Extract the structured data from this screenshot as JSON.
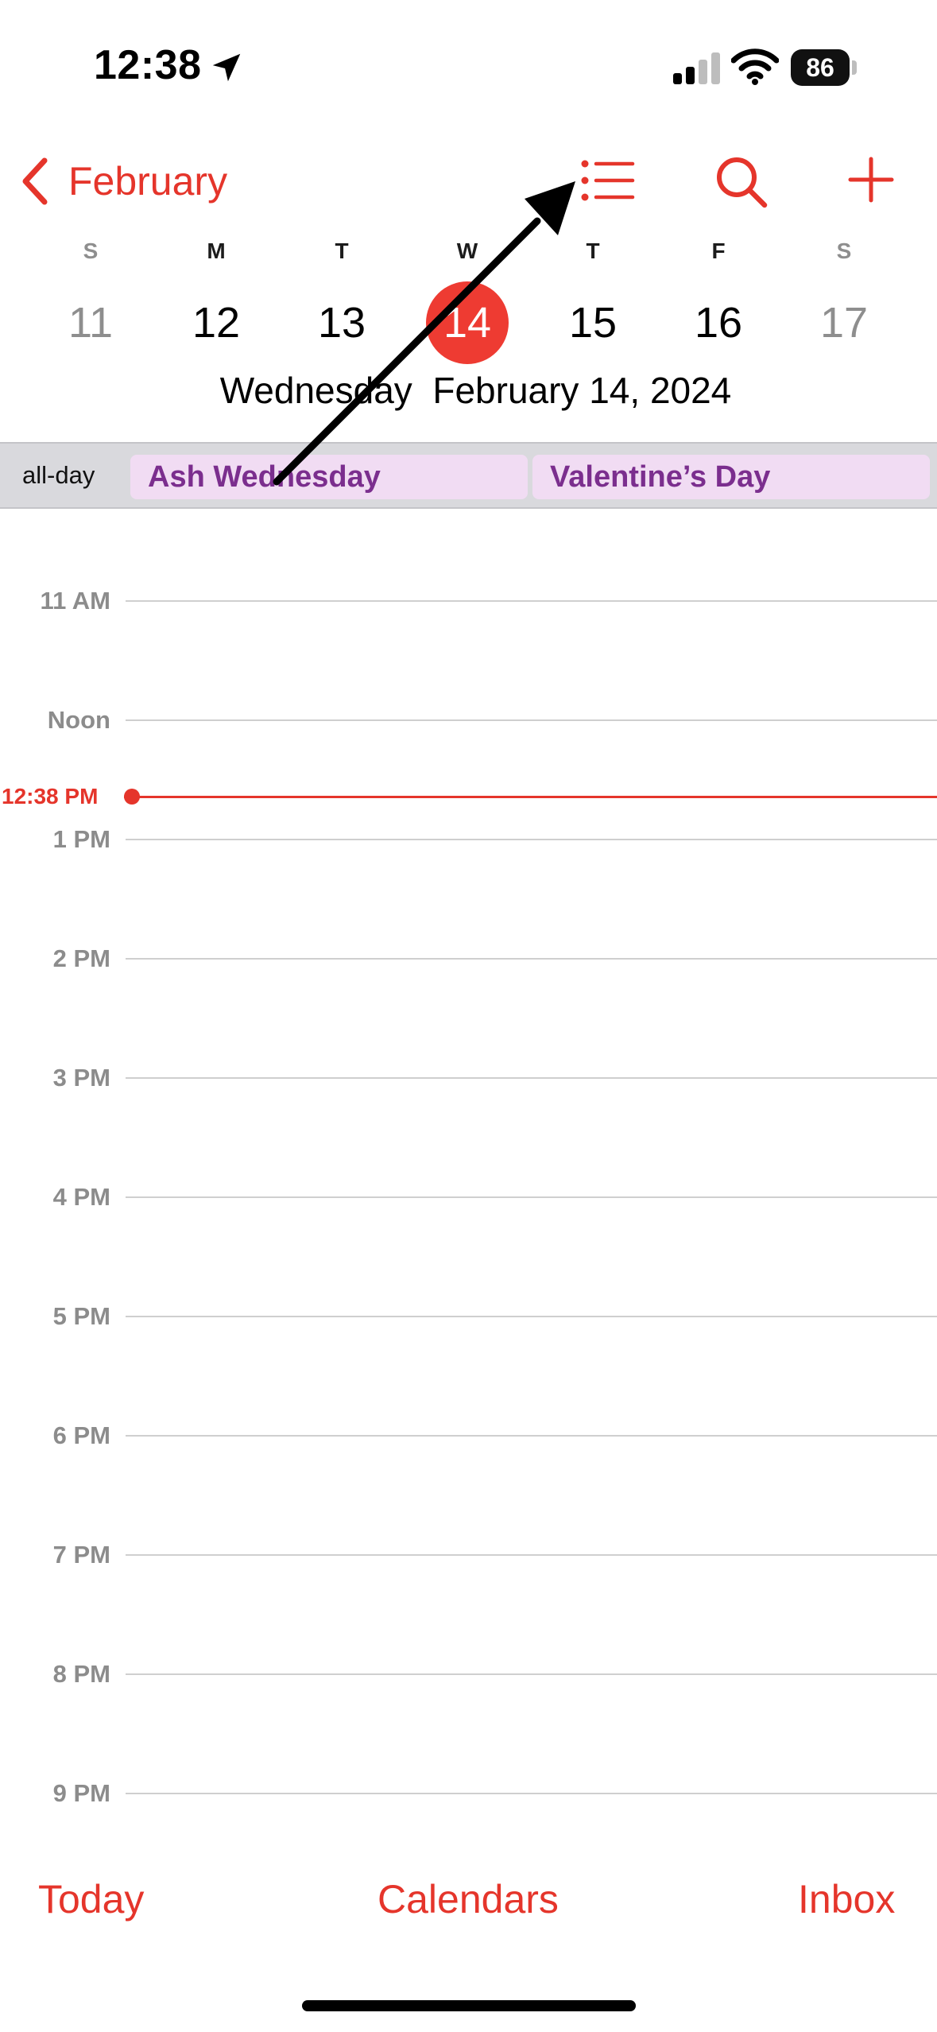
{
  "status_bar": {
    "time": "12:38",
    "battery": "86",
    "icons": [
      "location-arrow-icon",
      "cellular-signal-icon",
      "wifi-icon",
      "battery-icon"
    ]
  },
  "nav": {
    "back_label": "February",
    "icons": [
      "chevron-left-icon",
      "list-view-icon",
      "search-icon",
      "plus-icon"
    ]
  },
  "week": {
    "days": [
      {
        "letter": "S",
        "num": "11",
        "weekend": true,
        "selected": false
      },
      {
        "letter": "M",
        "num": "12",
        "weekend": false,
        "selected": false
      },
      {
        "letter": "T",
        "num": "13",
        "weekend": false,
        "selected": false
      },
      {
        "letter": "W",
        "num": "14",
        "weekend": false,
        "selected": true
      },
      {
        "letter": "T",
        "num": "15",
        "weekend": false,
        "selected": false
      },
      {
        "letter": "F",
        "num": "16",
        "weekend": false,
        "selected": false
      },
      {
        "letter": "S",
        "num": "17",
        "weekend": true,
        "selected": false
      }
    ],
    "date_line": "Wednesday  February 14, 2024"
  },
  "all_day": {
    "label": "all-day",
    "events": [
      "Ash Wednesday",
      "Valentine’s Day"
    ]
  },
  "timeline": {
    "hours": [
      "11 AM",
      "Noon",
      "1 PM",
      "2 PM",
      "3 PM",
      "4 PM",
      "5 PM",
      "6 PM",
      "7 PM",
      "8 PM",
      "9 PM"
    ],
    "current_time": "12:38 PM"
  },
  "tab_bar": {
    "today": "Today",
    "calendars": "Calendars",
    "inbox": "Inbox"
  },
  "colors": {
    "accent": "#e5352b",
    "event_bg": "#f1dcf3",
    "event_text": "#7b2e8e"
  }
}
